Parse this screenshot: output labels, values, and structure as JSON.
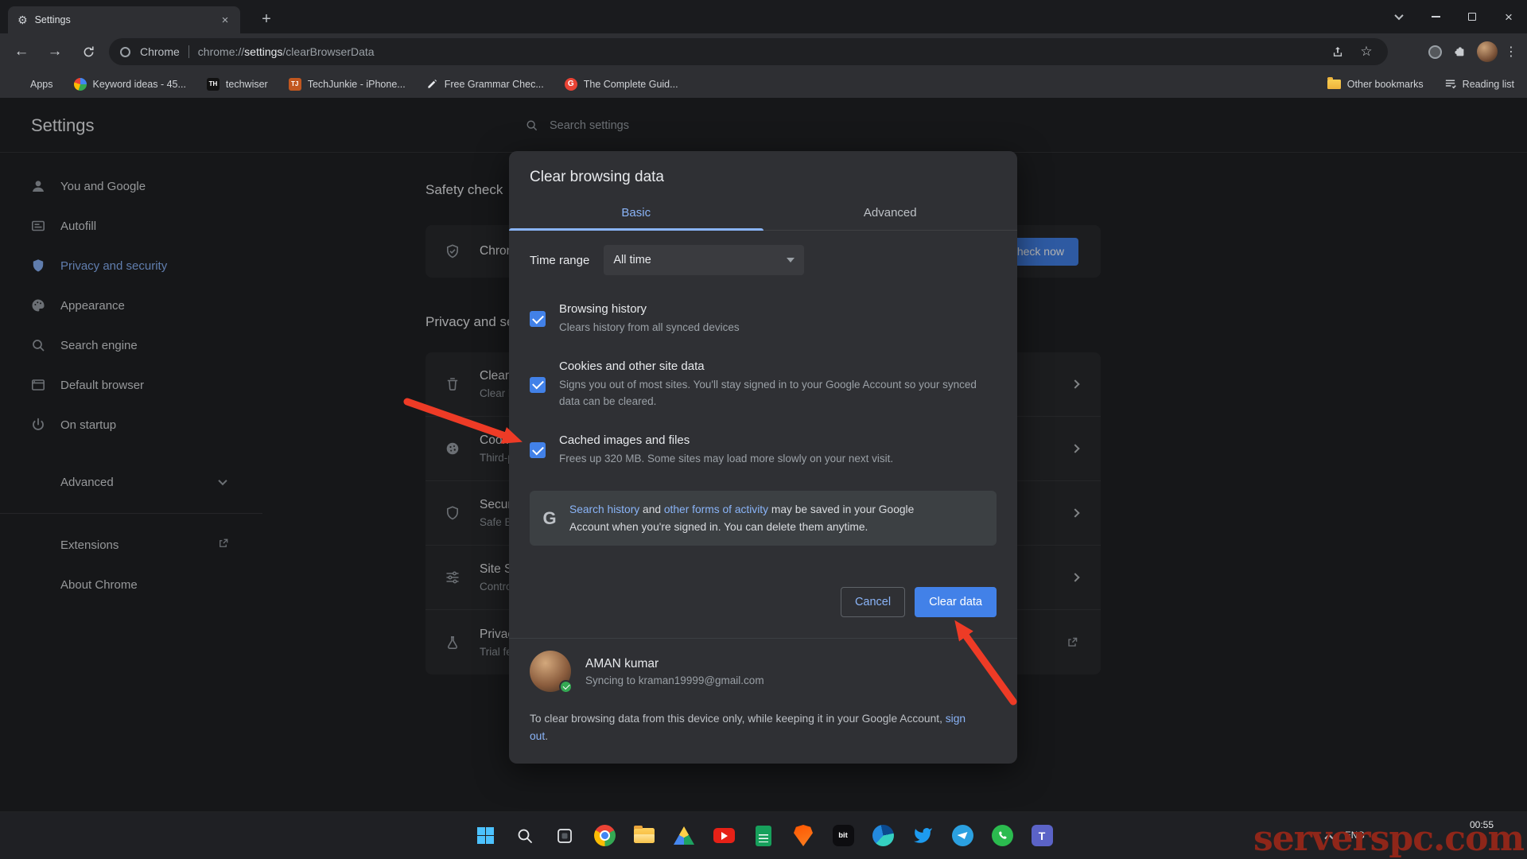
{
  "colors": {
    "accent": "#8ab4f8",
    "primary_button": "#4281e8",
    "page_background": "#202124",
    "dialog_background": "#2f3034",
    "annotation_arrow": "#ee3b26",
    "watermark": "#8f2619"
  },
  "glyphs": {
    "gear": "⚙",
    "close": "×",
    "plus": "+",
    "back": "←",
    "forward": "→",
    "star": "☆",
    "kebab": "⋮",
    "teams_t": "T"
  },
  "tabstrip": {
    "tab_title": "Settings"
  },
  "toolbar": {
    "url_app": "Chrome",
    "url_scheme": "chrome://",
    "url_host": "settings",
    "url_path": "/clearBrowserData"
  },
  "bookmarks": {
    "apps": "Apps",
    "items": [
      {
        "label": "Keyword ideas - 45..."
      },
      {
        "label": "techwiser",
        "favicon_text": "TH"
      },
      {
        "label": "TechJunkie - iPhone...",
        "favicon_text": "TJ"
      },
      {
        "label": "Free Grammar Chec..."
      },
      {
        "label": "The Complete Guid...",
        "favicon_text": "G"
      }
    ],
    "other_bookmarks": "Other bookmarks",
    "reading_list": "Reading list"
  },
  "settings": {
    "title": "Settings",
    "search_placeholder": "Search settings",
    "nav": [
      {
        "label": "You and Google"
      },
      {
        "label": "Autofill"
      },
      {
        "label": "Privacy and security"
      },
      {
        "label": "Appearance"
      },
      {
        "label": "Search engine"
      },
      {
        "label": "Default browser"
      },
      {
        "label": "On startup"
      }
    ],
    "advanced_label": "Advanced",
    "extensions_label": "Extensions",
    "about_label": "About Chrome",
    "safety": {
      "heading": "Safety check",
      "text": "Chrome can help keep you safe from data breaches, bad extensions, and more",
      "button": "Check now"
    },
    "privacy": {
      "heading": "Privacy and security",
      "rows": [
        {
          "title": "Clear browsing data",
          "desc": "Clear history, cookies, cache, and more"
        },
        {
          "title": "Cookies and other site data",
          "desc": "Third-party cookies are blocked in Incognito mode"
        },
        {
          "title": "Security",
          "desc": "Safe Browsing (protection from dangerous sites) and other security settings"
        },
        {
          "title": "Site Settings",
          "desc": "Controls what information sites can use and show (location, camera, pop-ups, and more)"
        },
        {
          "title": "Privacy Sandbox",
          "desc": "Trial features are on"
        }
      ]
    }
  },
  "dialog": {
    "title": "Clear browsing data",
    "tabs": {
      "basic": "Basic",
      "advanced": "Advanced"
    },
    "time_range_label": "Time range",
    "time_range_value": "All time",
    "checkboxes": [
      {
        "title": "Browsing history",
        "desc": "Clears history from all synced devices"
      },
      {
        "title": "Cookies and other site data",
        "desc": "Signs you out of most sites. You'll stay signed in to your Google Account so your synced data can be cleared."
      },
      {
        "title": "Cached images and files",
        "desc": "Frees up 320 MB. Some sites may load more slowly on your next visit."
      }
    ],
    "notice": {
      "g": "G",
      "link1": "Search history",
      "mid": " and ",
      "link2": "other forms of activity",
      "rest": " may be saved in your Google Account when you're signed in. You can delete them anytime."
    },
    "cancel": "Cancel",
    "confirm": "Clear data",
    "profile": {
      "name": "AMAN kumar",
      "status": "Syncing to kraman19999@gmail.com"
    },
    "footer": {
      "before": "To clear browsing data from this device only, while keeping it in your Google Account, ",
      "link": "sign out",
      "after": "."
    }
  },
  "taskbar": {
    "lang": "ENG",
    "time": "00:55",
    "bit_label": "bit"
  },
  "watermark": "serverspc.com"
}
